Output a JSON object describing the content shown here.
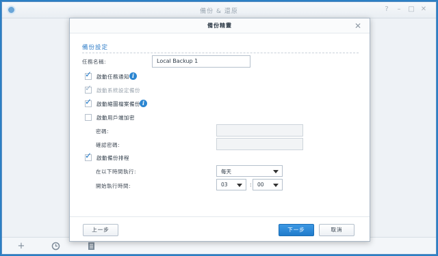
{
  "app": {
    "title": "備份 & 還原"
  },
  "dialog": {
    "title": "備份精靈",
    "section_title": "備份設定",
    "task_name_label": "任務名稱:",
    "task_name_value": "Local Backup 1",
    "options": [
      {
        "label": "啟動任務通知",
        "checked": true,
        "disabled": false
      },
      {
        "label": "啟動系統設定備份",
        "checked": true,
        "disabled": true
      },
      {
        "label": "啟動縮圖檔案備份",
        "checked": true,
        "disabled": false
      },
      {
        "label": "啟動用戶端加密",
        "checked": false,
        "disabled": false
      }
    ],
    "password_label": "密碼:",
    "confirm_password_label": "確認密碼:",
    "schedule_label": "啟動備份排程",
    "schedule_checked": true,
    "run_on_label": "在以下時間執行:",
    "run_on_value": "每天",
    "start_time_label": "開始執行時間:",
    "hour_value": "03",
    "minute_value": "00",
    "time_separator": ":",
    "prev_button": "上一步",
    "next_button": "下一步",
    "cancel_button": "取消"
  },
  "colors": {
    "accent": "#2f7dc8",
    "primary_button": "#1f7bcb",
    "desktop": "#2b7fc4"
  }
}
